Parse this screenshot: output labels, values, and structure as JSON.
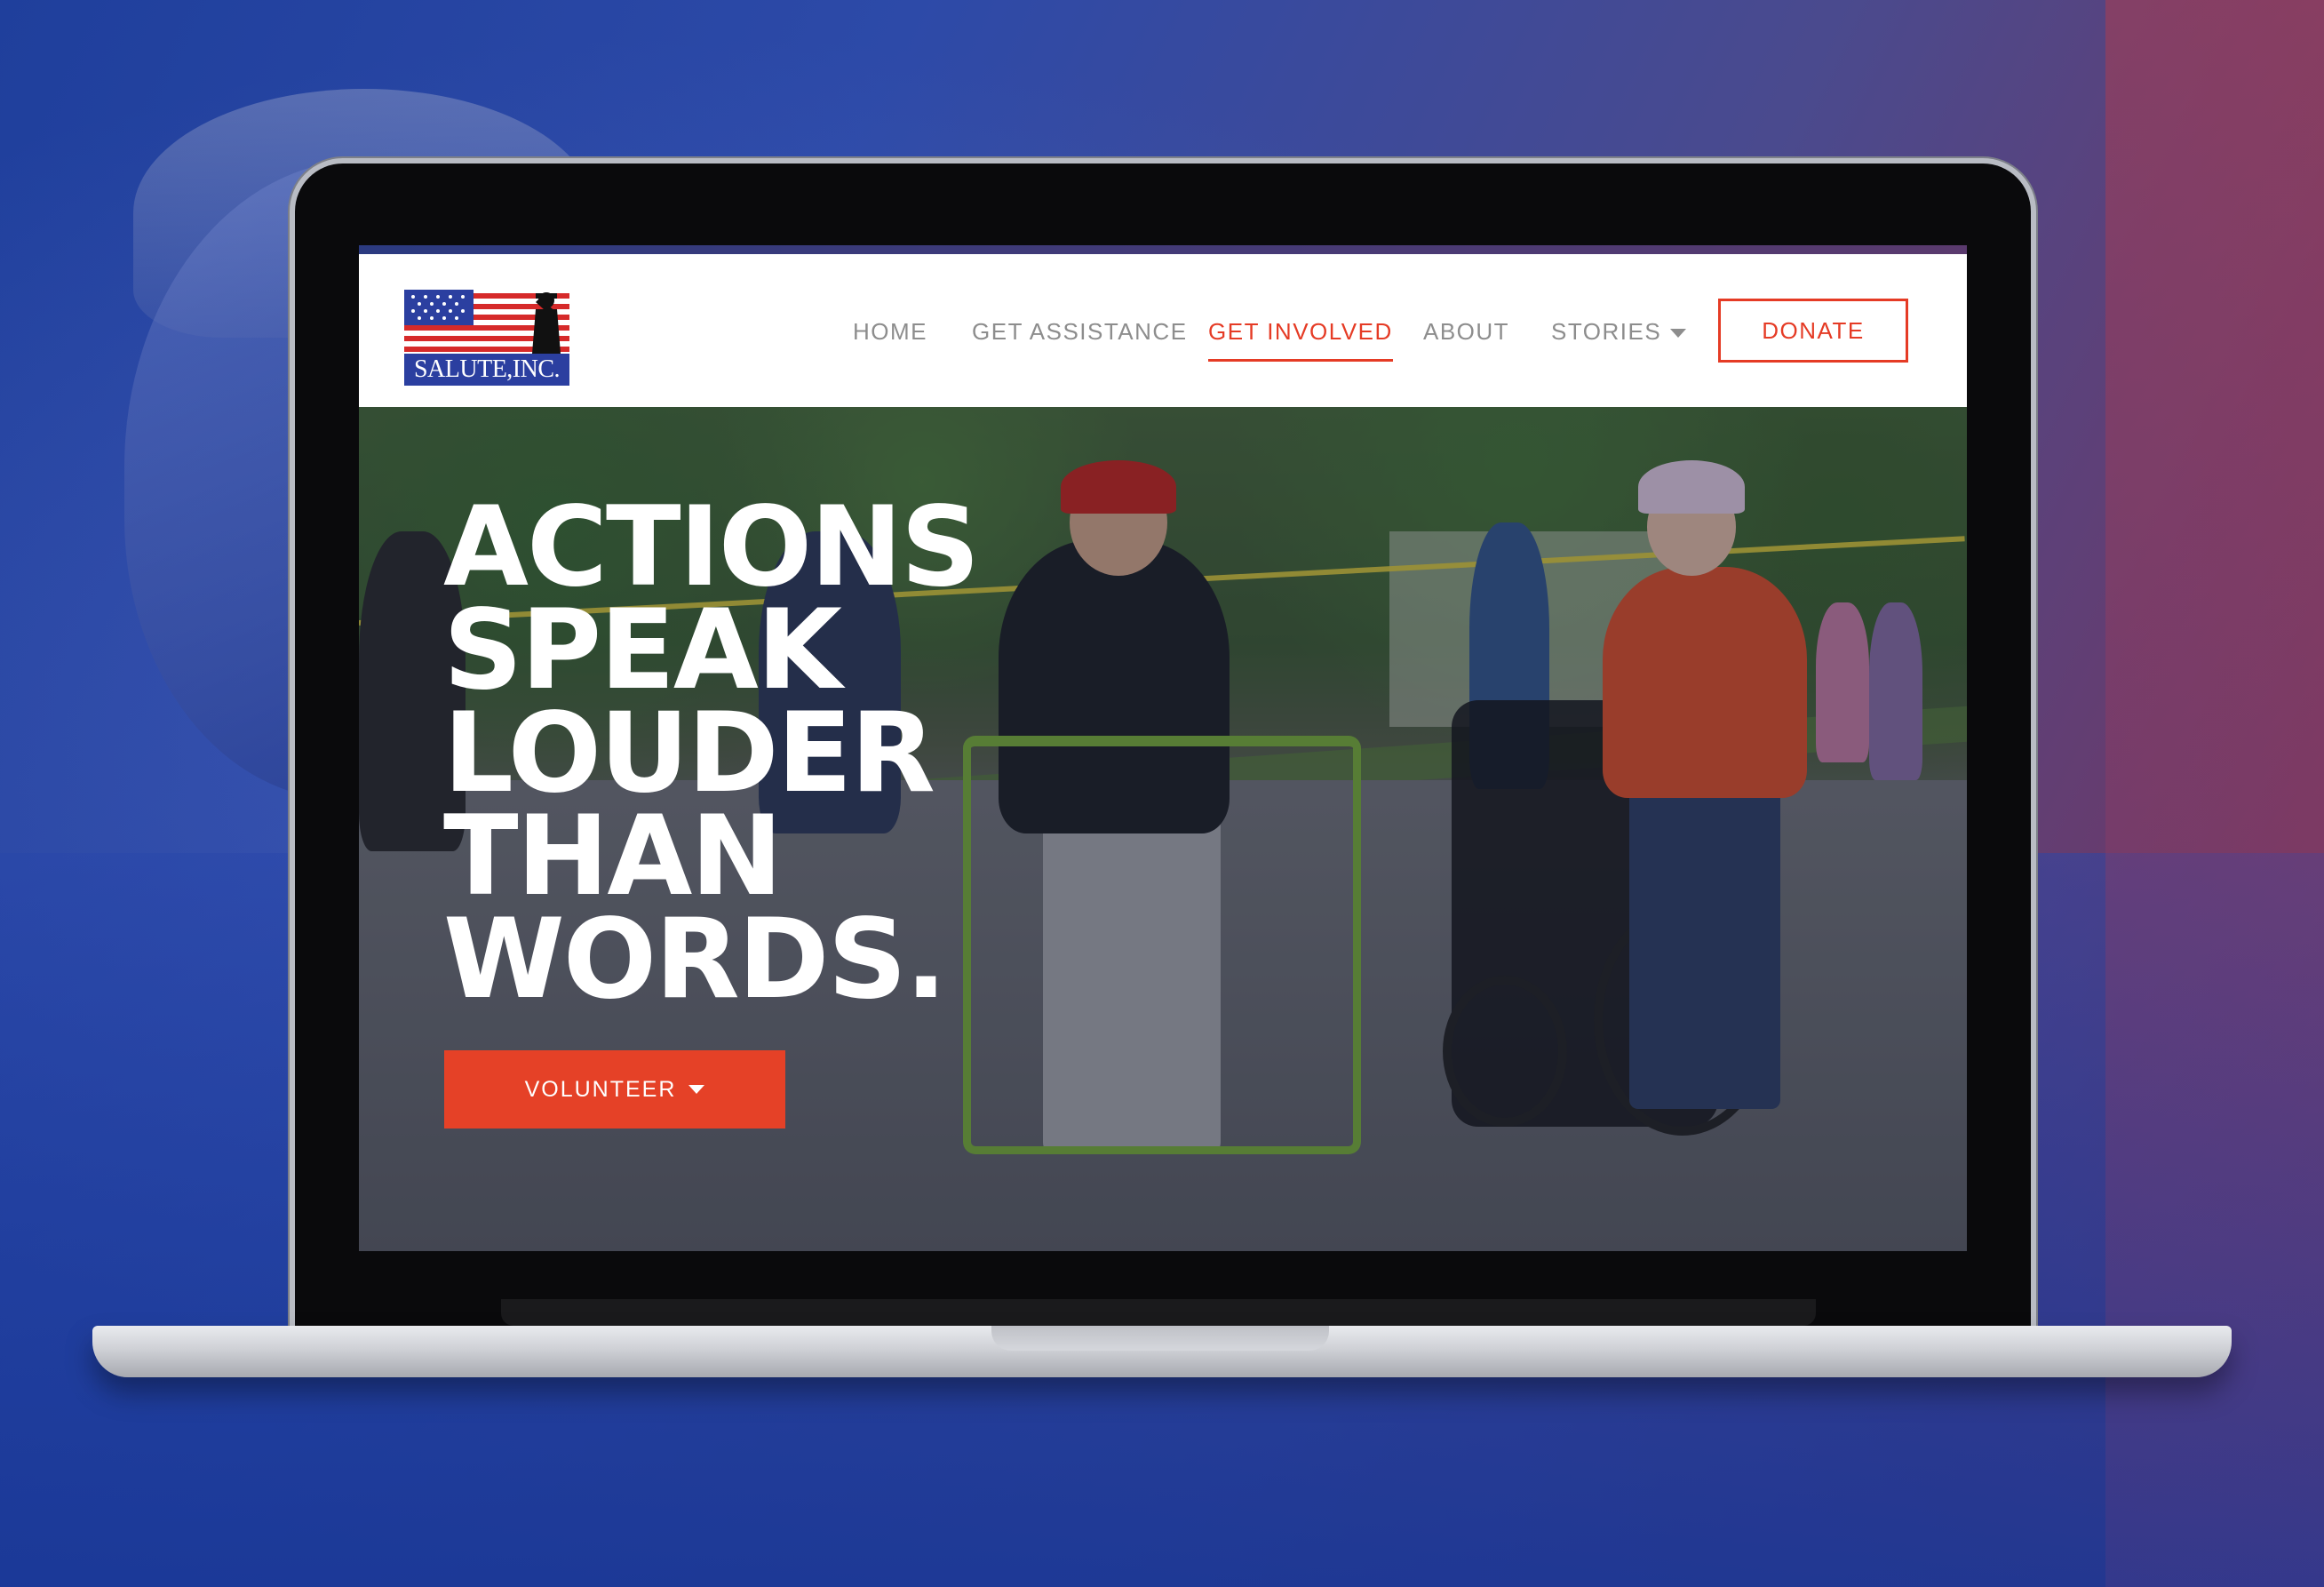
{
  "brand": {
    "logo_text": "SALUTE,INC.",
    "colors": {
      "accent": "#e53b25",
      "logo_blue": "#2b3fa0",
      "walker_green": "#7bb33a"
    }
  },
  "nav": {
    "items": [
      {
        "label": "HOME",
        "active": false
      },
      {
        "label": "GET ASSISTANCE",
        "active": false
      },
      {
        "label": "GET INVOLVED",
        "active": true
      },
      {
        "label": "ABOUT",
        "active": false
      },
      {
        "label": "STORIES",
        "active": false,
        "has_dropdown": true
      }
    ],
    "donate_label": "DONATE"
  },
  "hero": {
    "headline_lines": [
      "ACTIONS",
      "SPEAK",
      "LOUDER",
      "THAN",
      "WORDS."
    ],
    "cta_label": "VOLUNTEER",
    "cta_icon": "caret-down-icon"
  },
  "icons": {
    "stories_dropdown": "caret-down-icon",
    "logo_figure": "saluting-soldier-icon",
    "logo_flag": "american-flag-icon"
  }
}
